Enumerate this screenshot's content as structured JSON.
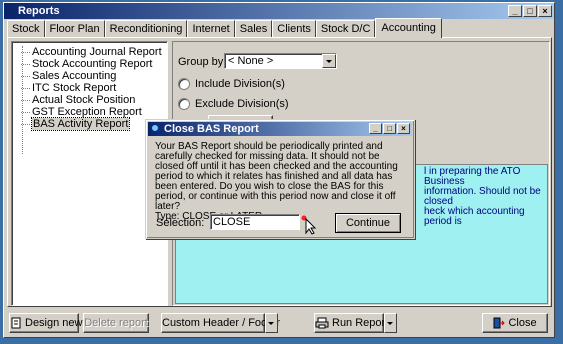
{
  "window": {
    "title": "Reports"
  },
  "tabs": [
    "Stock",
    "Floor Plan",
    "Reconditioning",
    "Internet",
    "Sales",
    "Clients",
    "Stock D/C",
    "Accounting"
  ],
  "active_tab": "Accounting",
  "tree": {
    "items": [
      "Accounting Journal Report",
      "Stock Accounting Report",
      "Sales Accounting",
      "ITC Stock Report",
      "Actual Stock Position",
      "GST Exception Report",
      "BAS Activity Report"
    ],
    "selected": "BAS Activity Report"
  },
  "options": {
    "group_by_label": "Group by",
    "group_by_value": "< None >",
    "include_divisions": "Include Division(s)",
    "exclude_divisions": "Exclude Division(s)"
  },
  "description": {
    "lines": [
      "l in preparing the ATO Business",
      "information.  Should not be closed",
      "heck which accounting period is"
    ]
  },
  "dialog": {
    "title": "Close BAS Report",
    "message": "Your BAS Report should be periodically printed and carefully checked for missing data.  It should not be closed off until it has been checked and the accounting period to which it relates has finished and all data has been entered.  Do you wish to close the BAS for this period, or continue with this period now and close it off later?",
    "type_hint": "Type:  CLOSE or LATER",
    "selection_label": "Selection:",
    "selection_value": "CLOSE",
    "continue_label": "Continue"
  },
  "bottom_bar": {
    "design_new": "Design new",
    "delete_report": "Delete report",
    "custom_header_footer": "Custom Header / Footer",
    "run_report": "Run Report",
    "close": "Close"
  },
  "colors": {
    "title_bar_start": "#0a246a",
    "title_bar_end": "#a6caf0",
    "description_bg": "#9ff0f0",
    "description_text": "#000080"
  }
}
